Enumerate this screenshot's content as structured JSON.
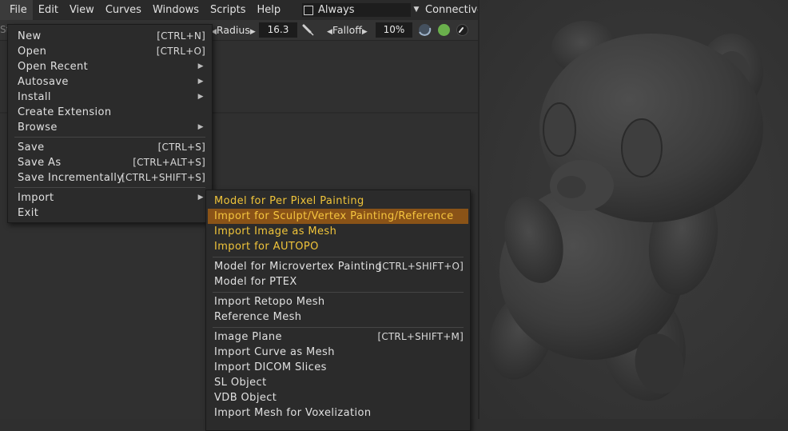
{
  "menubar": {
    "items": [
      "File",
      "Edit",
      "View",
      "Curves",
      "Windows",
      "Scripts",
      "Help"
    ],
    "mode_select": "Always",
    "connect_label": "Connective"
  },
  "toolbar": {
    "ghost_text": "St",
    "radius_label": "Radius",
    "radius_value": "16.3",
    "falloff_label": "Falloff",
    "falloff_value": "10%",
    "color_dot": "#6ab04c"
  },
  "file_menu": {
    "items": [
      {
        "label": "New",
        "shortcut": "[CTRL+N]"
      },
      {
        "label": "Open",
        "shortcut": "[CTRL+O]"
      },
      {
        "label": "Open Recent",
        "shortcut": ""
      },
      {
        "label": "Autosave",
        "shortcut": ""
      },
      {
        "label": "Install",
        "shortcut": ""
      },
      {
        "label": "Create Extension",
        "shortcut": ""
      },
      {
        "label": "Browse",
        "shortcut": ""
      },
      {
        "label": "Save",
        "shortcut": "[CTRL+S]"
      },
      {
        "label": "Save As",
        "shortcut": "[CTRL+ALT+S]"
      },
      {
        "label": "Save Incrementally",
        "shortcut": "[CTRL+SHIFT+S]"
      },
      {
        "label": "Import",
        "shortcut": ""
      },
      {
        "label": "Exit",
        "shortcut": ""
      }
    ]
  },
  "import_menu": {
    "items": [
      {
        "label": "Model for Per Pixel Painting",
        "shortcut": ""
      },
      {
        "label": "Import for Sculpt/Vertex Painting/Reference",
        "shortcut": ""
      },
      {
        "label": "Import Image as Mesh",
        "shortcut": ""
      },
      {
        "label": "Import for AUTOPO",
        "shortcut": ""
      },
      {
        "label": "Model for Microvertex Painting",
        "shortcut": "[CTRL+SHIFT+O]"
      },
      {
        "label": "Model for PTEX",
        "shortcut": ""
      },
      {
        "label": "Import Retopo Mesh",
        "shortcut": ""
      },
      {
        "label": "Reference Mesh",
        "shortcut": ""
      },
      {
        "label": "Image Plane",
        "shortcut": "[CTRL+SHIFT+M]"
      },
      {
        "label": "Import Curve as Mesh",
        "shortcut": ""
      },
      {
        "label": "Import DICOM Slices",
        "shortcut": ""
      },
      {
        "label": "SL Object",
        "shortcut": ""
      },
      {
        "label": "VDB Object",
        "shortcut": ""
      },
      {
        "label": "Import Mesh for Voxelization",
        "shortcut": ""
      }
    ]
  },
  "colors": {
    "highlight": "#8a5317",
    "highlight_text": "#f6c53e",
    "accent_text": "#f0c43a"
  }
}
